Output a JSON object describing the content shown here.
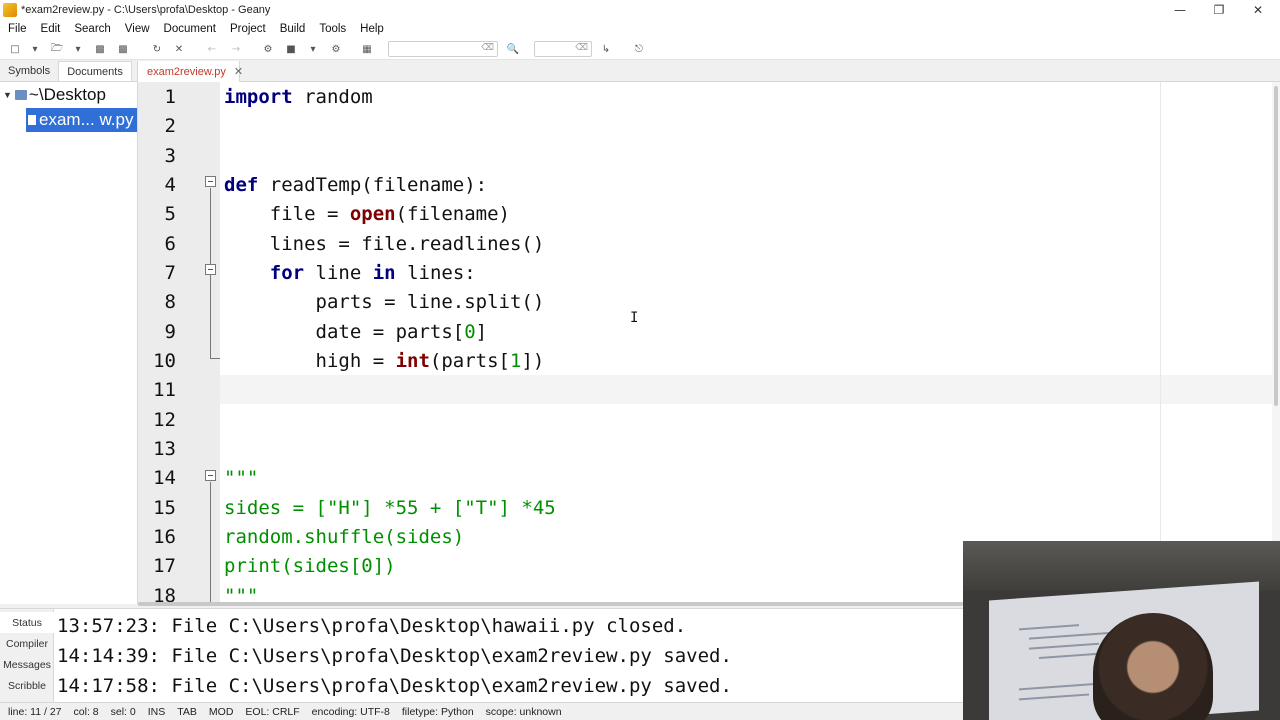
{
  "window": {
    "title": "*exam2review.py - C:\\Users\\profa\\Desktop - Geany"
  },
  "menu": [
    "File",
    "Edit",
    "Search",
    "View",
    "Document",
    "Project",
    "Build",
    "Tools",
    "Help"
  ],
  "sidebar": {
    "tabs": [
      "Symbols",
      "Documents"
    ],
    "active_tab": "Documents",
    "tree_root": "~\\Desktop",
    "tree_file": "exam... w.py"
  },
  "editor": {
    "tab_label": "exam2review.py",
    "current_line": 11
  },
  "code_lines": [
    {
      "n": "1"
    },
    {
      "n": "2"
    },
    {
      "n": "3"
    },
    {
      "n": "4"
    },
    {
      "n": "5"
    },
    {
      "n": "6"
    },
    {
      "n": "7"
    },
    {
      "n": "8"
    },
    {
      "n": "9"
    },
    {
      "n": "10"
    },
    {
      "n": "11"
    },
    {
      "n": "12"
    },
    {
      "n": "13"
    },
    {
      "n": "14"
    },
    {
      "n": "15"
    },
    {
      "n": "16"
    },
    {
      "n": "17"
    },
    {
      "n": "18"
    }
  ],
  "code": {
    "l1_kw": "import",
    "l1_rest": " random",
    "l4_kw": "def",
    "l4_rest": " readTemp(filename):",
    "l5_a": "    file = ",
    "l5_b": "open",
    "l5_c": "(filename)",
    "l6": "    lines = file.readlines()",
    "l7_a": "    ",
    "l7_kw1": "for",
    "l7_b": " line ",
    "l7_kw2": "in",
    "l7_c": " lines:",
    "l8": "        parts = line.split()",
    "l9_a": "        date = parts[",
    "l9_num": "0",
    "l9_b": "]",
    "l10_a": "        high = ",
    "l10_bi": "int",
    "l10_b": "(parts[",
    "l10_num": "1",
    "l10_c": "])",
    "l14": "\"\"\"",
    "l15": "sides = [\"H\"] *55 + [\"T\"] *45",
    "l16": "random.shuffle(sides)",
    "l17": "print(sides[0])",
    "l18": "\"\"\""
  },
  "messages": {
    "tabs": [
      "Status",
      "Compiler",
      "Messages",
      "Scribble"
    ],
    "lines": [
      "13:57:23: File C:\\Users\\profa\\Desktop\\hawaii.py closed.",
      "14:14:39: File C:\\Users\\profa\\Desktop\\exam2review.py saved.",
      "14:17:58: File C:\\Users\\profa\\Desktop\\exam2review.py saved."
    ]
  },
  "status": {
    "line": "line: 11 / 27",
    "col": "col: 8",
    "sel": "sel: 0",
    "ins": "INS",
    "tab": "TAB",
    "mod": "MOD",
    "eol": "EOL: CRLF",
    "encoding": "encoding: UTF-8",
    "filetype": "filetype: Python",
    "scope": "scope: unknown"
  },
  "colors": {
    "keyword": "#00007f",
    "builtin": "#7f0000",
    "number": "#008f00",
    "string": "#008f00",
    "selection": "#2f6fd6",
    "modified_tab": "#c0392b"
  }
}
